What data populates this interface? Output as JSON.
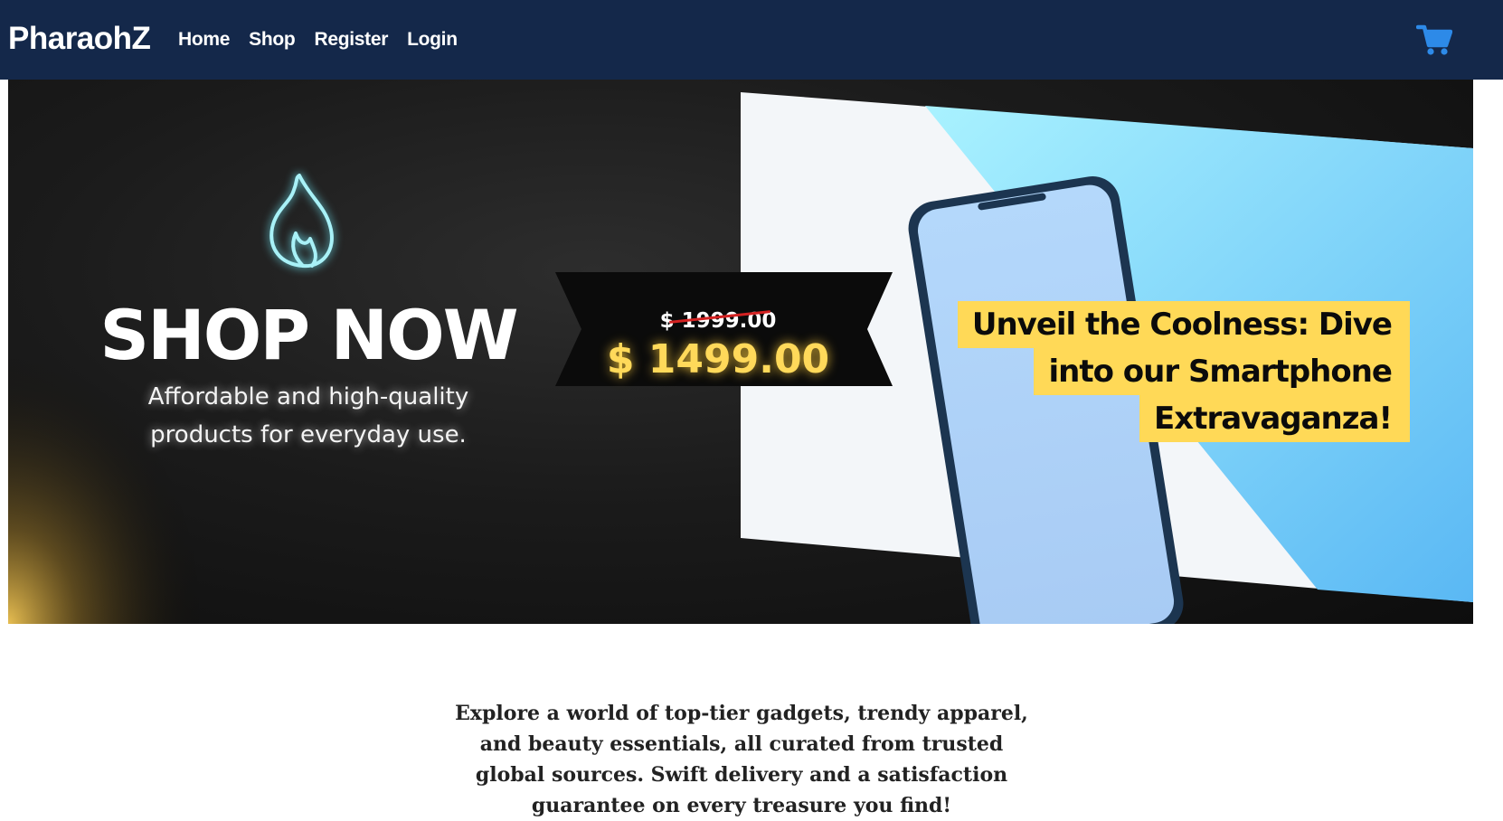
{
  "navbar": {
    "brand": "PharaohZ",
    "links": [
      {
        "label": "Home"
      },
      {
        "label": "Shop"
      },
      {
        "label": "Register"
      },
      {
        "label": "Login"
      }
    ],
    "cart_icon": "shopping-cart-icon",
    "background_color": "#14284a",
    "cart_color": "#2d8ae8"
  },
  "banner": {
    "flame_icon": "flame-icon",
    "headline": "SHOP NOW",
    "tagline_line1": "Affordable and high-quality",
    "tagline_line2": "products for everyday use.",
    "old_price": "$ 1999.00",
    "new_price": "$ 1499.00",
    "promo_line1": "Unveil the Coolness: Dive",
    "promo_line2": "into our Smartphone",
    "promo_line3": "Extravaganza!",
    "accent_color": "#ffd957",
    "price_color": "#ffd95a"
  },
  "intro": {
    "text": "Explore a world of top-tier gadgets, trendy apparel, and beauty essentials, all curated from trusted global sources. Swift delivery and a satisfaction guarantee on every treasure you find!"
  }
}
